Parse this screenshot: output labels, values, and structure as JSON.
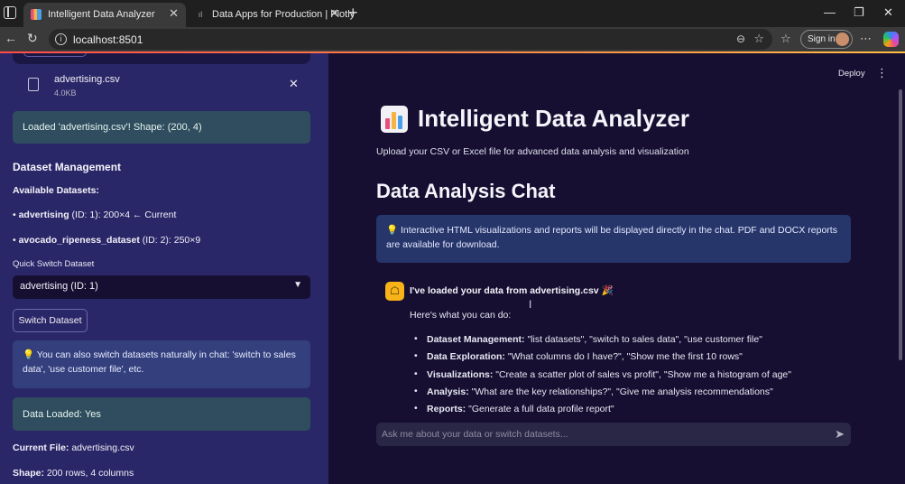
{
  "browser": {
    "tabs": [
      {
        "title": "Intelligent Data Analyzer",
        "active": true
      },
      {
        "title": "Data Apps for Production | Plotly",
        "active": false
      }
    ],
    "url": "localhost:8501",
    "signin_label": "Sign in"
  },
  "sidebar": {
    "file": {
      "name": "advertising.csv",
      "size": "4.0KB"
    },
    "loaded_msg": "Loaded 'advertising.csv'! Shape: (200, 4)",
    "dataset_mgmt_header": "Dataset Management",
    "available_label": "Available Datasets:",
    "datasets": [
      {
        "name": "advertising",
        "detail": " (ID: 1): 200×4 ← Current"
      },
      {
        "name": "avocado_ripeness_dataset",
        "detail": " (ID: 2): 250×9"
      }
    ],
    "quick_switch_label": "Quick Switch Dataset",
    "select_value": "advertising (ID: 1)",
    "switch_button": "Switch Dataset",
    "tip": "💡 You can also switch datasets naturally in chat: 'switch to sales data', 'use customer file', etc.",
    "data_loaded": "Data Loaded: Yes",
    "current_file_label": "Current File:",
    "current_file_value": " advertising.csv",
    "shape_label": "Shape:",
    "shape_value": " 200 rows, 4 columns"
  },
  "main": {
    "deploy_label": "Deploy",
    "title": "Intelligent Data Analyzer",
    "subtitle": "Upload your CSV or Excel file for advanced data analysis and visualization",
    "chat_title": "Data Analysis Chat",
    "info_text": "💡 Interactive HTML visualizations and reports will be displayed directly in the chat. PDF and DOCX reports are available for download.",
    "message": {
      "title": "I've loaded your data from advertising.csv 🎉",
      "intro": "Here's what you can do:",
      "items": [
        {
          "label": "Dataset Management:",
          "text": " \"list datasets\", \"switch to sales data\", \"use customer file\""
        },
        {
          "label": "Data Exploration:",
          "text": " \"What columns do I have?\", \"Show me the first 10 rows\""
        },
        {
          "label": "Visualizations:",
          "text": " \"Create a scatter plot of sales vs profit\", \"Show me a histogram of age\""
        },
        {
          "label": "Analysis:",
          "text": " \"What are the key relationships?\", \"Give me analysis recommendations\""
        },
        {
          "label": "Reports:",
          "text": " \"Generate a full data profile report\""
        }
      ]
    },
    "chat_placeholder": "Ask me about your data or switch datasets..."
  },
  "colors": {
    "sidebar_bg": "#2a2768",
    "main_bg": "#160f31",
    "success_bg": "#2f4d5f",
    "info_bg": "#33407d",
    "avatar_bg": "#f8b319"
  },
  "icons": [
    "window-icon",
    "tab-favicon",
    "back-icon",
    "refresh-icon",
    "info-icon",
    "zoom-icon",
    "star-icon",
    "favorites-icon",
    "more-icon",
    "copilot-icon",
    "file-icon",
    "close-icon",
    "chevron-down-icon",
    "kebab-icon",
    "bar-chart-icon",
    "bot-icon",
    "send-icon"
  ]
}
